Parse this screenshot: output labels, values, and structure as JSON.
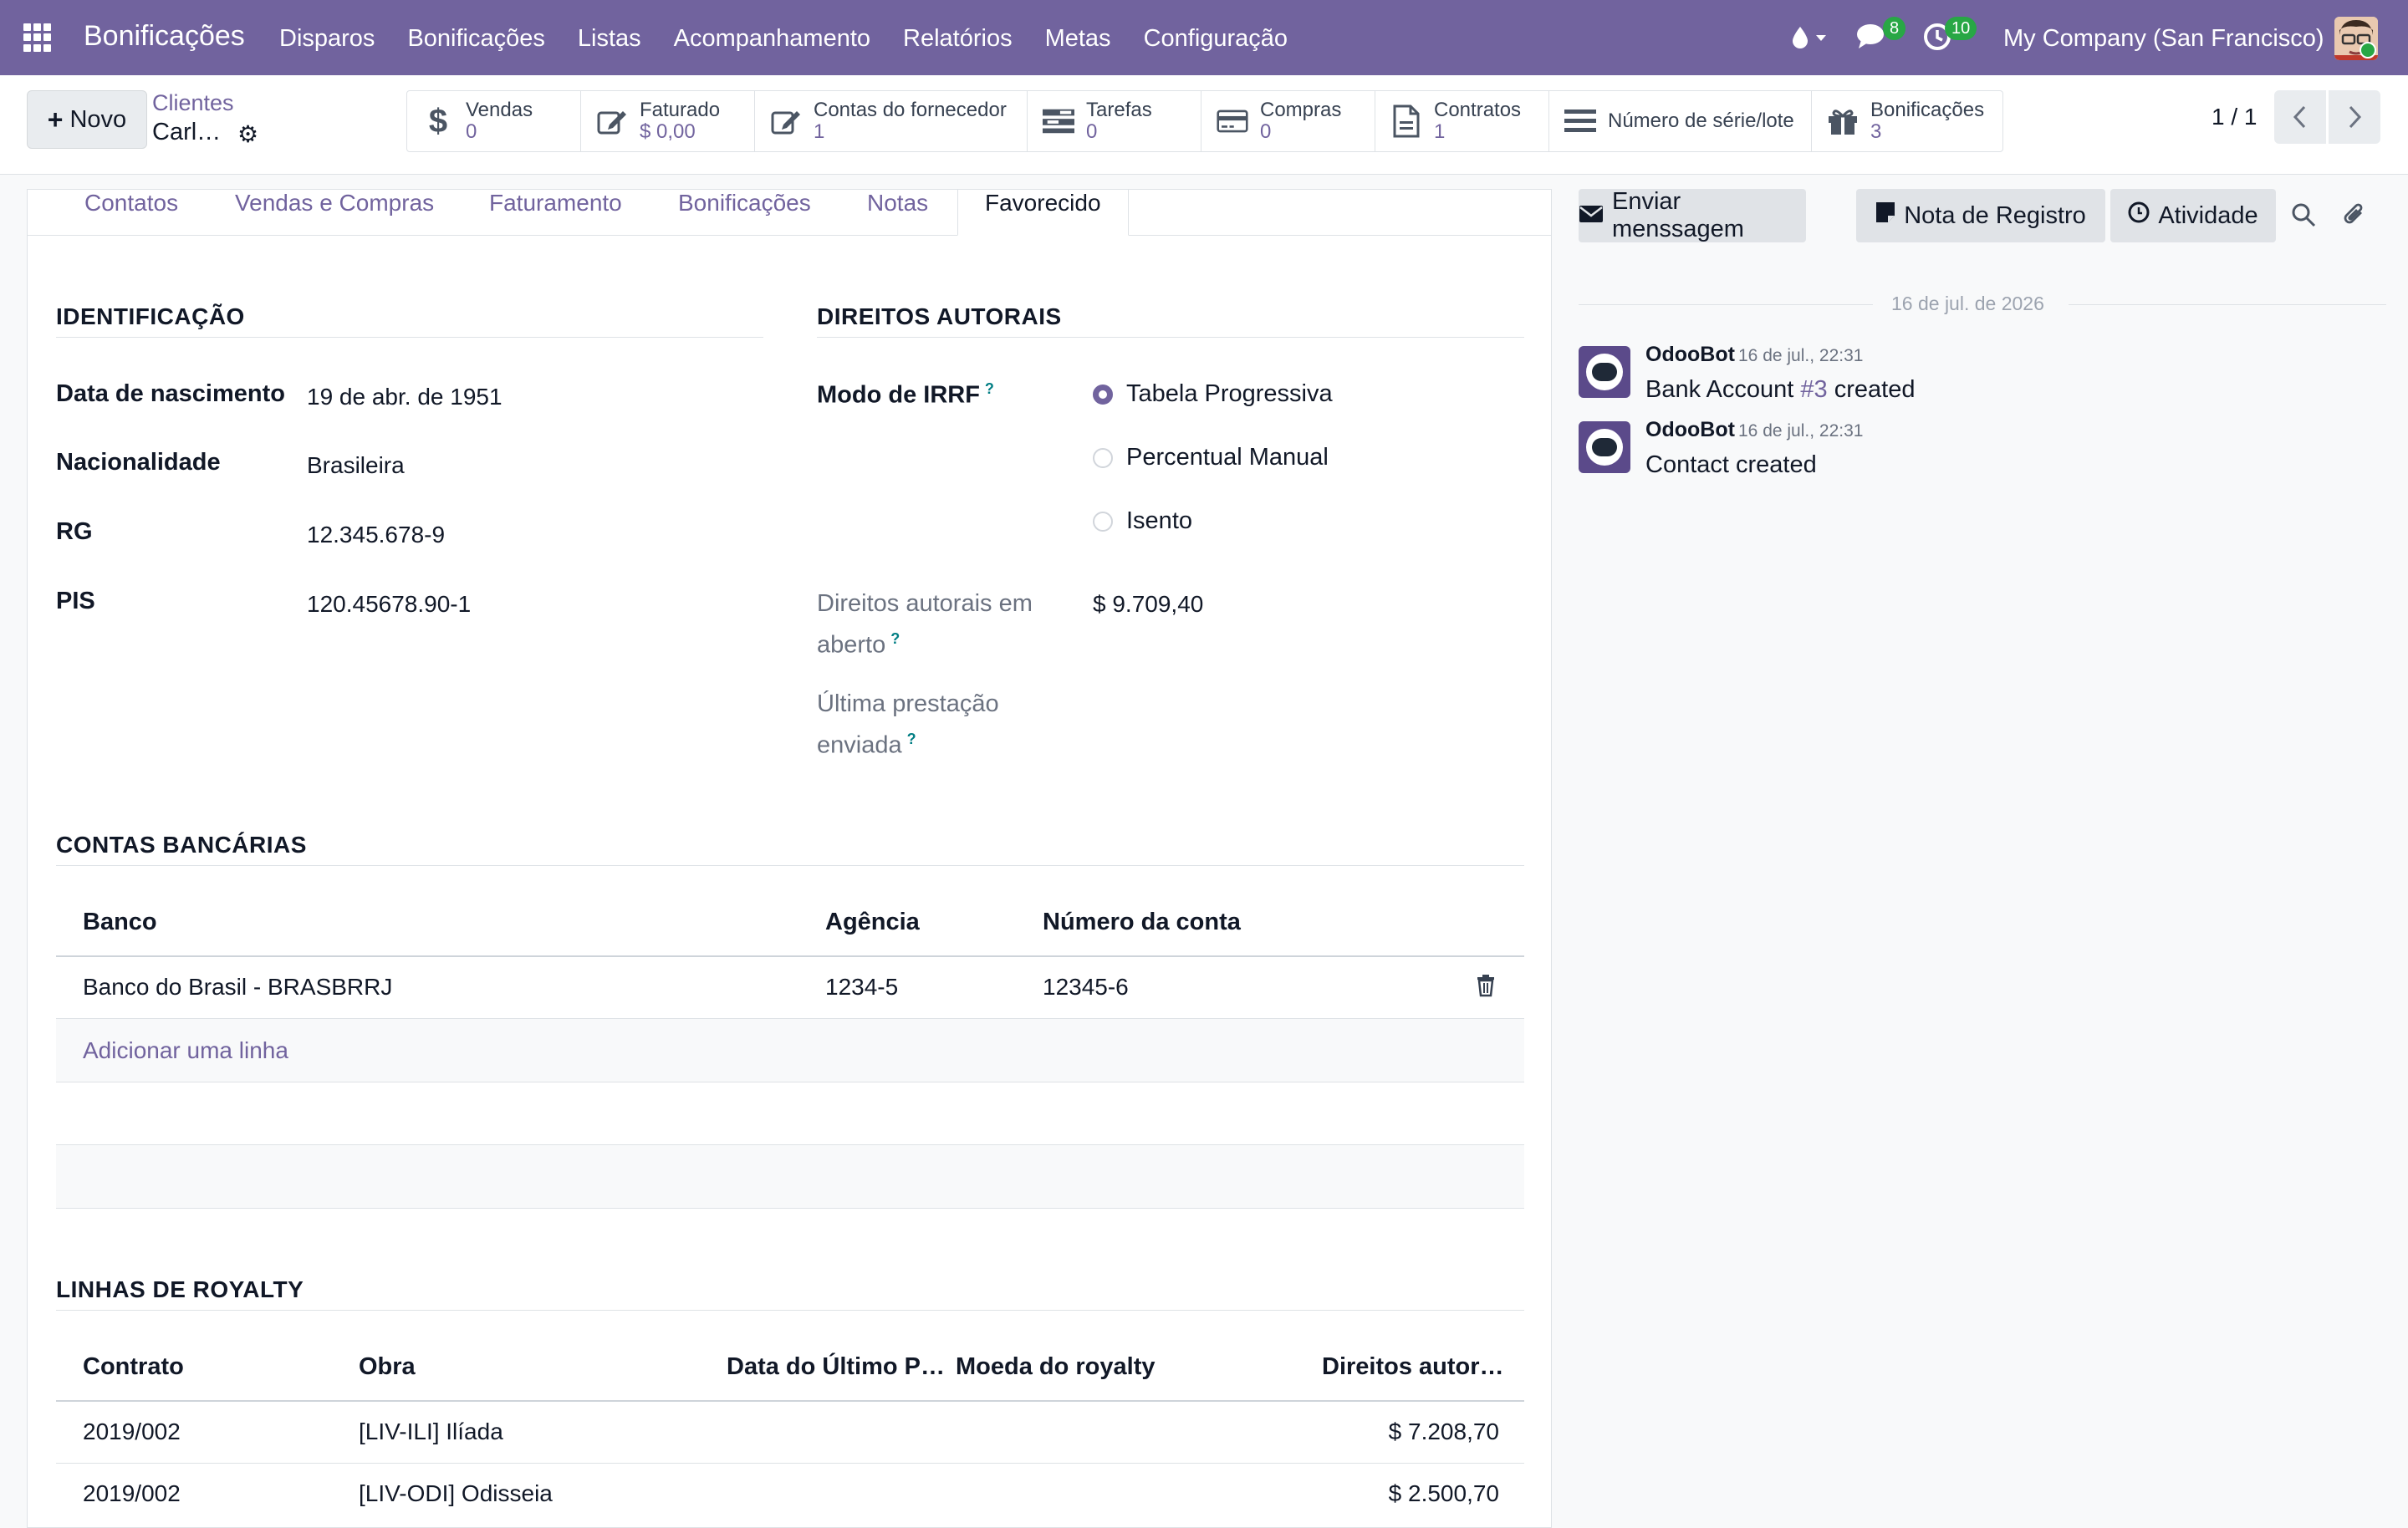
{
  "navbar": {
    "brand": "Bonificações",
    "menu": [
      "Disparos",
      "Bonificações",
      "Listas",
      "Acompanhamento",
      "Relatórios",
      "Metas",
      "Configuração"
    ],
    "messages_count": "8",
    "activities_count": "10",
    "company": "My Company (San Francisco)"
  },
  "control": {
    "new_label": "Novo",
    "breadcrumb_parent": "Clientes",
    "breadcrumb_current": "Carl…",
    "smart_buttons": [
      {
        "label": "Vendas",
        "value": "0",
        "icon": "dollar-icon"
      },
      {
        "label": "Faturado",
        "value": "$ 0,00",
        "icon": "pencil-square-icon"
      },
      {
        "label": "Contas do fornecedor",
        "value": "1",
        "icon": "pencil-square-icon"
      },
      {
        "label": "Tarefas",
        "value": "0",
        "icon": "tasks-icon"
      },
      {
        "label": "Compras",
        "value": "0",
        "icon": "credit-card-icon"
      },
      {
        "label": "Contratos",
        "value": "1",
        "icon": "file-icon"
      },
      {
        "label": "Número de série/lote",
        "value": "",
        "icon": "bars-icon"
      },
      {
        "label": "Bonificações",
        "value": "3",
        "icon": "gift-icon"
      }
    ],
    "pager": "1 / 1"
  },
  "tabs": [
    "Contatos",
    "Vendas e Compras",
    "Faturamento",
    "Bonificações",
    "Notas",
    "Favorecido"
  ],
  "identificacao": {
    "title": "IDENTIFICAÇÃO",
    "fields": [
      {
        "label": "Data de nascimento",
        "value": "19 de abr. de 1951"
      },
      {
        "label": "Nacionalidade",
        "value": "Brasileira"
      },
      {
        "label": "RG",
        "value": "12.345.678-9"
      },
      {
        "label": "PIS",
        "value": "120.45678.90-1"
      }
    ]
  },
  "direitos": {
    "title": "DIREITOS AUTORAIS",
    "irrf_label": "Modo de IRRF",
    "irrf_options": [
      "Tabela Progressiva",
      "Percentual Manual",
      "Isento"
    ],
    "irrf_selected": "Tabela Progressiva",
    "aberto_label": "Direitos autorais em aberto",
    "aberto_value": "$ 9.709,40",
    "ultima_label": "Última prestação enviada"
  },
  "bank": {
    "title": "CONTAS BANCÁRIAS",
    "headers": [
      "Banco",
      "Agência",
      "Número da conta"
    ],
    "rows": [
      {
        "bank": "Banco do Brasil - BRASBRRJ",
        "agency": "1234-5",
        "account": "12345-6"
      }
    ],
    "add_line": "Adicionar uma linha"
  },
  "royalty": {
    "title": "LINHAS DE ROYALTY",
    "headers": [
      "Contrato",
      "Obra",
      "Data do Último P…",
      "Moeda do royalty",
      "Direitos autor…"
    ],
    "rows": [
      {
        "contract": "2019/002",
        "work": "[LIV-ILI] Ilíada",
        "date": "",
        "currency": "",
        "amount": "$ 7.208,70"
      },
      {
        "contract": "2019/002",
        "work": "[LIV-ODI] Odisseia",
        "date": "",
        "currency": "",
        "amount": "$ 2.500,70"
      }
    ]
  },
  "chatter": {
    "send_message": "Enviar menssagem",
    "log_note": "Nota de Registro",
    "activity": "Atividade",
    "date_separator": "16 de jul. de 2026",
    "messages": [
      {
        "author": "OdooBot",
        "time": "16 de jul., 22:31",
        "body_prefix": "Bank Account ",
        "body_link": "#3",
        "body_suffix": " created"
      },
      {
        "author": "OdooBot",
        "time": "16 de jul., 22:31",
        "body_prefix": "Contact created",
        "body_link": "",
        "body_suffix": ""
      }
    ]
  },
  "colors": {
    "brand": "#71639e",
    "badge": "#28a745"
  }
}
